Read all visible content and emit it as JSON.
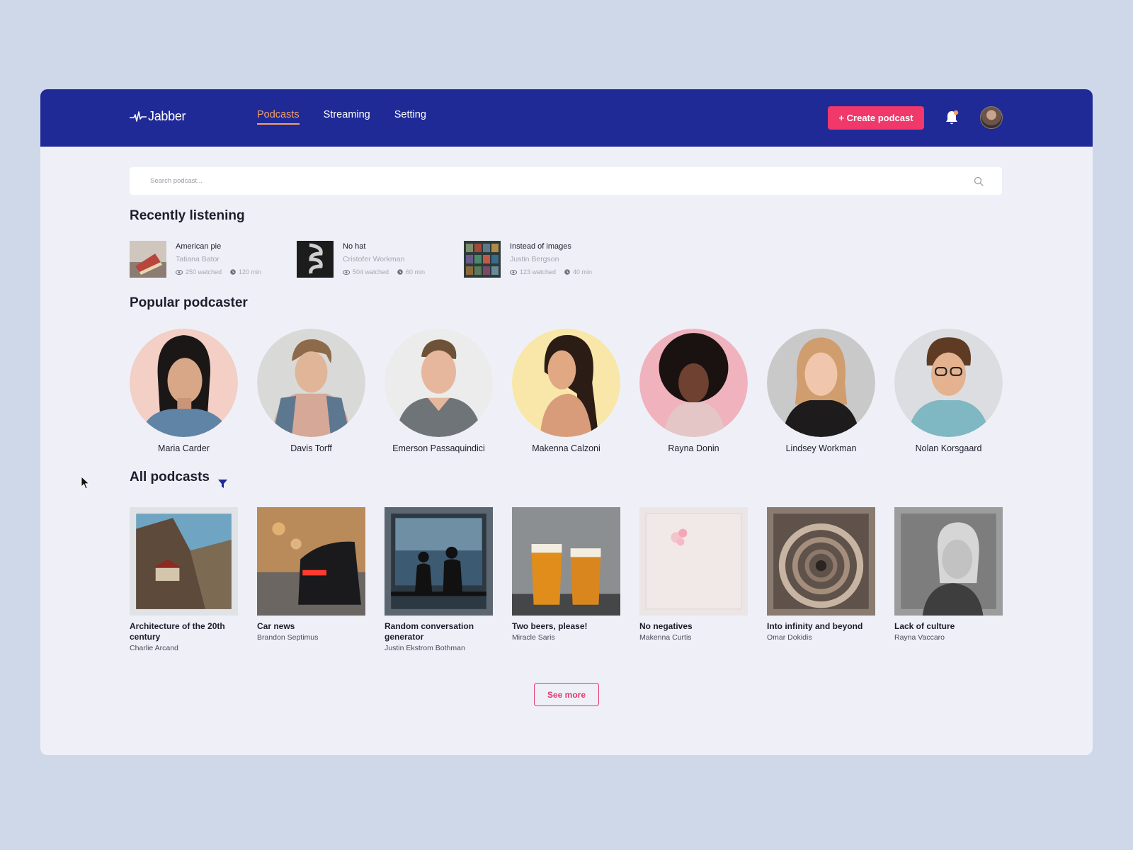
{
  "brand": {
    "name": "Jabber"
  },
  "nav": [
    {
      "label": "Podcasts",
      "active": true
    },
    {
      "label": "Streaming",
      "active": false
    },
    {
      "label": "Setting",
      "active": false
    }
  ],
  "header": {
    "create_label": "+ Create podcast",
    "bell_icon": "bell-icon",
    "accent": "#f0386b",
    "brand_color": "#1f2a96"
  },
  "search": {
    "placeholder": "Search podcast..."
  },
  "recent": {
    "title": "Recently listening",
    "items": [
      {
        "title": "American pie",
        "author": "Tatiana Bator",
        "watched": "250 watched",
        "duration": "120 min"
      },
      {
        "title": "No hat",
        "author": "Cristofer Workman",
        "watched": "504 watched",
        "duration": "60 min"
      },
      {
        "title": "Instead of images",
        "author": "Justin Bergson",
        "watched": "123 watched",
        "duration": "40 min"
      }
    ]
  },
  "popular": {
    "title": "Popular podcaster",
    "items": [
      {
        "name": "Maria Carder"
      },
      {
        "name": "Davis Torff"
      },
      {
        "name": "Emerson Passaquindici"
      },
      {
        "name": "Makenna Calzoni"
      },
      {
        "name": "Rayna Donin"
      },
      {
        "name": "Lindsey Workman"
      },
      {
        "name": "Nolan Korsgaard"
      }
    ]
  },
  "all": {
    "title": "All podcasts",
    "filter_icon": "filter-icon",
    "items": [
      {
        "title": "Architecture of the 20th century",
        "author": "Charlie Arcand"
      },
      {
        "title": "Car news",
        "author": "Brandon Septimus"
      },
      {
        "title": "Random conversation generator",
        "author": "Justin Ekstrom Bothman"
      },
      {
        "title": "Two beers, please!",
        "author": "Miracle Saris"
      },
      {
        "title": "No negatives",
        "author": "Makenna Curtis"
      },
      {
        "title": "Into infinity and beyond",
        "author": "Omar Dokidis"
      },
      {
        "title": "Lack of culture",
        "author": "Rayna Vaccaro"
      }
    ],
    "see_more": "See more"
  }
}
